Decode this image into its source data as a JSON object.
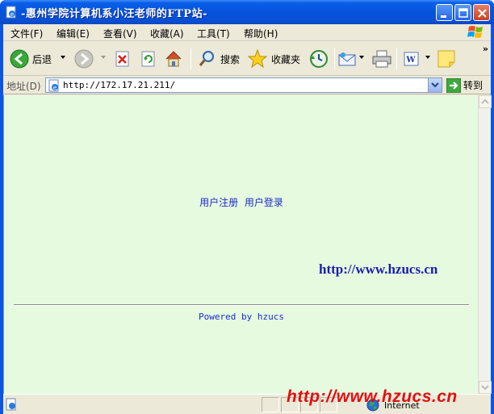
{
  "window": {
    "title": "-惠州学院计算机系小汪老师的FTP站-"
  },
  "menu": {
    "items": [
      "文件(F)",
      "编辑(E)",
      "查看(V)",
      "收藏(A)",
      "工具(T)",
      "帮助(H)"
    ]
  },
  "toolbar": {
    "back_label": "后退",
    "search_label": "搜索",
    "favorites_label": "收藏夹"
  },
  "address": {
    "label": "地址(D)",
    "value": "http://172.17.21.211/",
    "go_label": "转到"
  },
  "page": {
    "register_link": "用户注册",
    "login_link": "用户登录",
    "site_url": "http://www.hzucs.cn",
    "powered_by": "Powered by hzucs"
  },
  "status": {
    "zone": "Internet"
  },
  "watermark": {
    "text": "http://www.hzucs.cn"
  },
  "colors": {
    "content_background": "#e6fae0",
    "link": "#1c2bc8",
    "watermark": "#e01010",
    "titlebar": "#0553dc"
  }
}
